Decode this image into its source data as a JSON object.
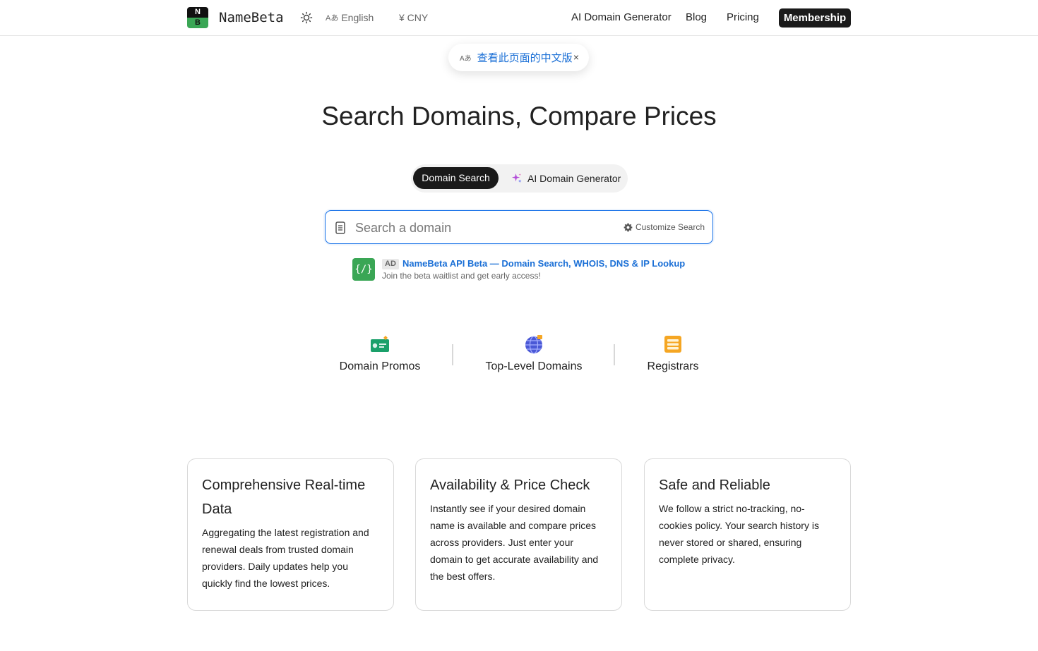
{
  "header": {
    "logo_top": "N",
    "logo_bottom": "B",
    "brand": "NameBeta",
    "language": "English",
    "currency": "¥ CNY",
    "nav": [
      "AI Domain Generator",
      "Blog",
      "Pricing"
    ],
    "membership": "Membership"
  },
  "translate_banner": {
    "icon_text": "A",
    "link_text": "查看此页面的中文版",
    "close": "×"
  },
  "hero": {
    "title": "Search Domains, Compare Prices"
  },
  "tabs": {
    "active": "Domain Search",
    "ai": "AI Domain Generator"
  },
  "search": {
    "placeholder": "Search a domain",
    "value": "",
    "customize": "Customize Search"
  },
  "ad": {
    "icon_text": "{/}",
    "badge": "AD",
    "title": "NameBeta API Beta — Domain Search, WHOIS, DNS & IP Lookup",
    "subtitle": "Join the beta waitlist and get early access!"
  },
  "categories": [
    {
      "label": "Domain Promos",
      "icon": "promo-ticket-icon"
    },
    {
      "label": "Top-Level Domains",
      "icon": "globe-icon"
    },
    {
      "label": "Registrars",
      "icon": "server-list-icon"
    }
  ],
  "features": [
    {
      "title": "Comprehensive Real-time Data",
      "text": "Aggregating the latest registration and renewal deals from trusted domain providers. Daily updates help you quickly find the lowest prices."
    },
    {
      "title": "Availability & Price Check",
      "text": "Instantly see if your desired domain name is available and compare prices across providers. Just enter your domain to get accurate availability and the best offers."
    },
    {
      "title": "Safe and Reliable",
      "text": "We follow a strict no-tracking, no-cookies policy. Your search history is never stored or shared, ensuring complete privacy."
    }
  ],
  "colors": {
    "accent_blue": "#1a6fd6",
    "brand_green": "#3aa655",
    "dark": "#1a1a1a"
  }
}
